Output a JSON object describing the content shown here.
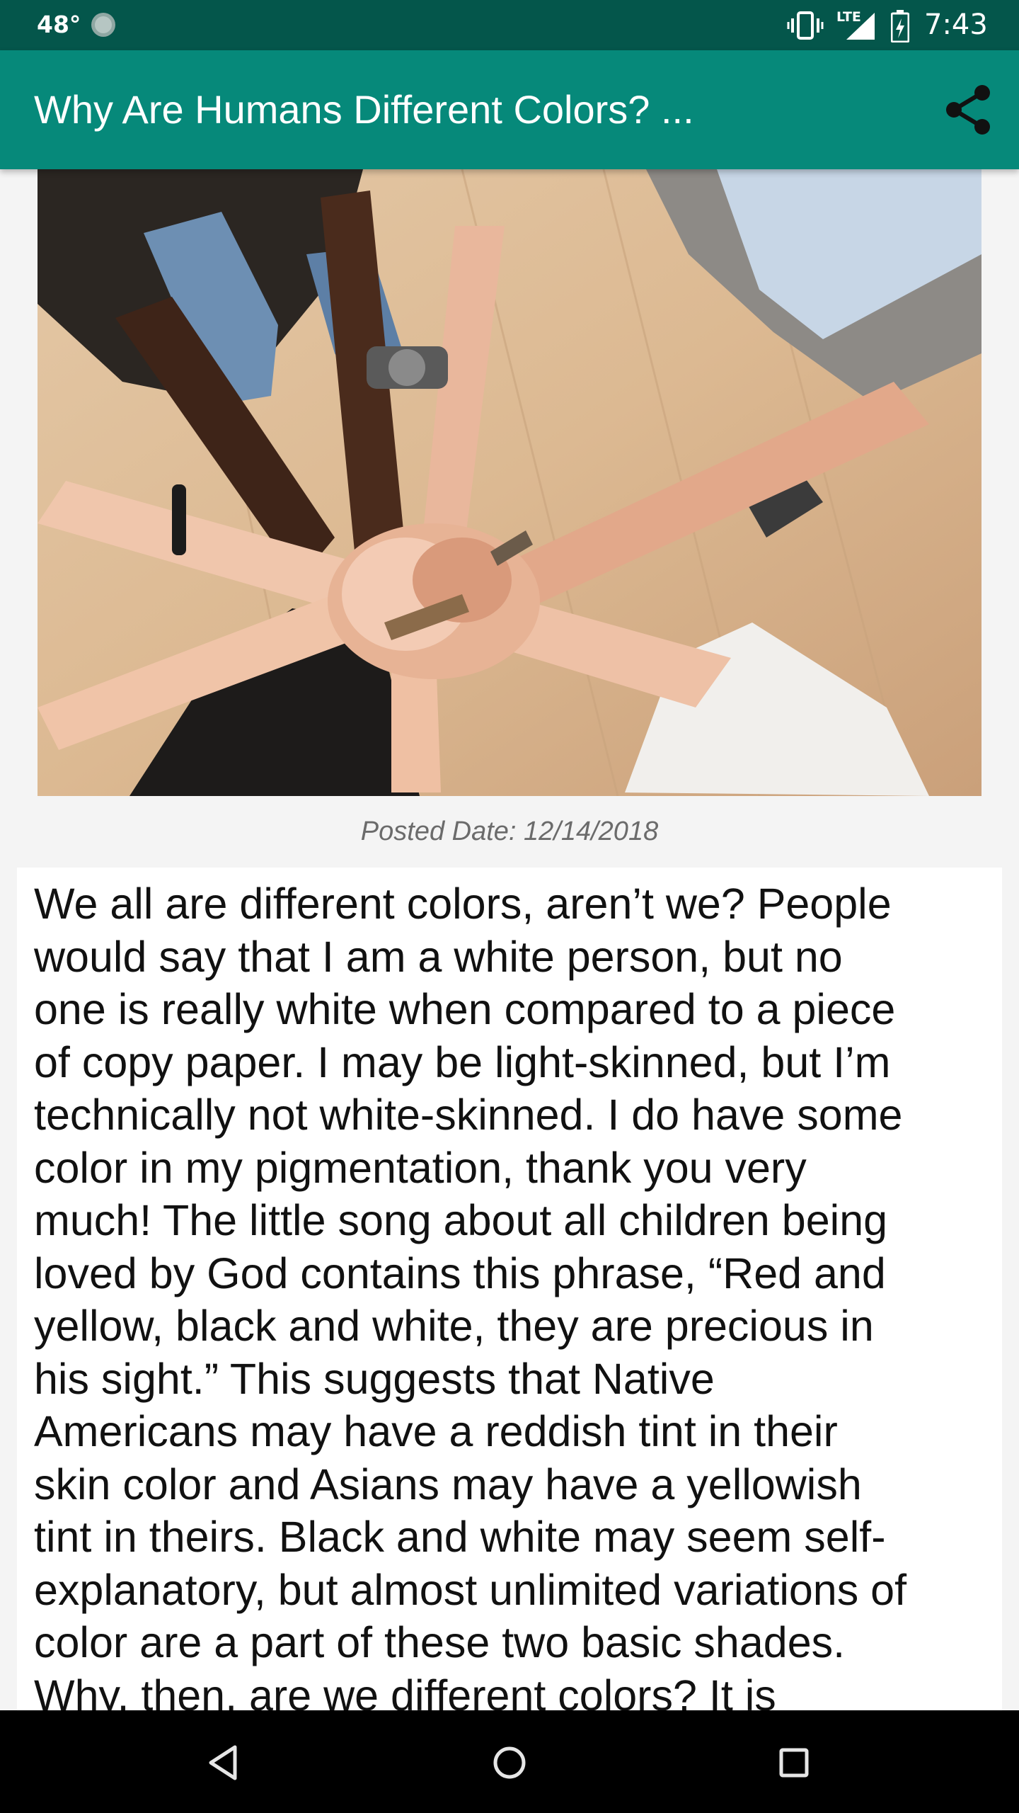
{
  "status_bar": {
    "temperature": "48°",
    "network_label": "LTE",
    "time": "7:43"
  },
  "app_bar": {
    "title": "Why Are Humans Different Colors? ..."
  },
  "article": {
    "image_icon": "photo-of-stacked-hands",
    "posted_date": "Posted Date: 12/14/2018",
    "body": "We all are different colors, aren’t we? People\nwould say that I am a white person, but no\none is really white when compared to a piece\nof copy paper. I may be light-skinned, but I’m\ntechnically not white-skinned. I do have some\ncolor in my pigmentation, thank you very\nmuch! The little song about all children being\nloved by God contains this phrase, “Red and\nyellow, black and white, they are precious in\nhis sight.” This suggests that Native\nAmericans may have a reddish tint in their\nskin color and Asians may have a yellowish\ntint in theirs. Black and white may seem self-\nexplanatory, but almost unlimited variations of\ncolor are a part of these two basic shades.\nWhy, then, are we different colors? It is"
  },
  "nav_bar": {
    "icons": [
      "back-icon",
      "home-icon",
      "recents-icon"
    ]
  },
  "colors": {
    "status_bar": "#04564b",
    "app_bar": "#06897a",
    "background": "#f4f4f4"
  }
}
